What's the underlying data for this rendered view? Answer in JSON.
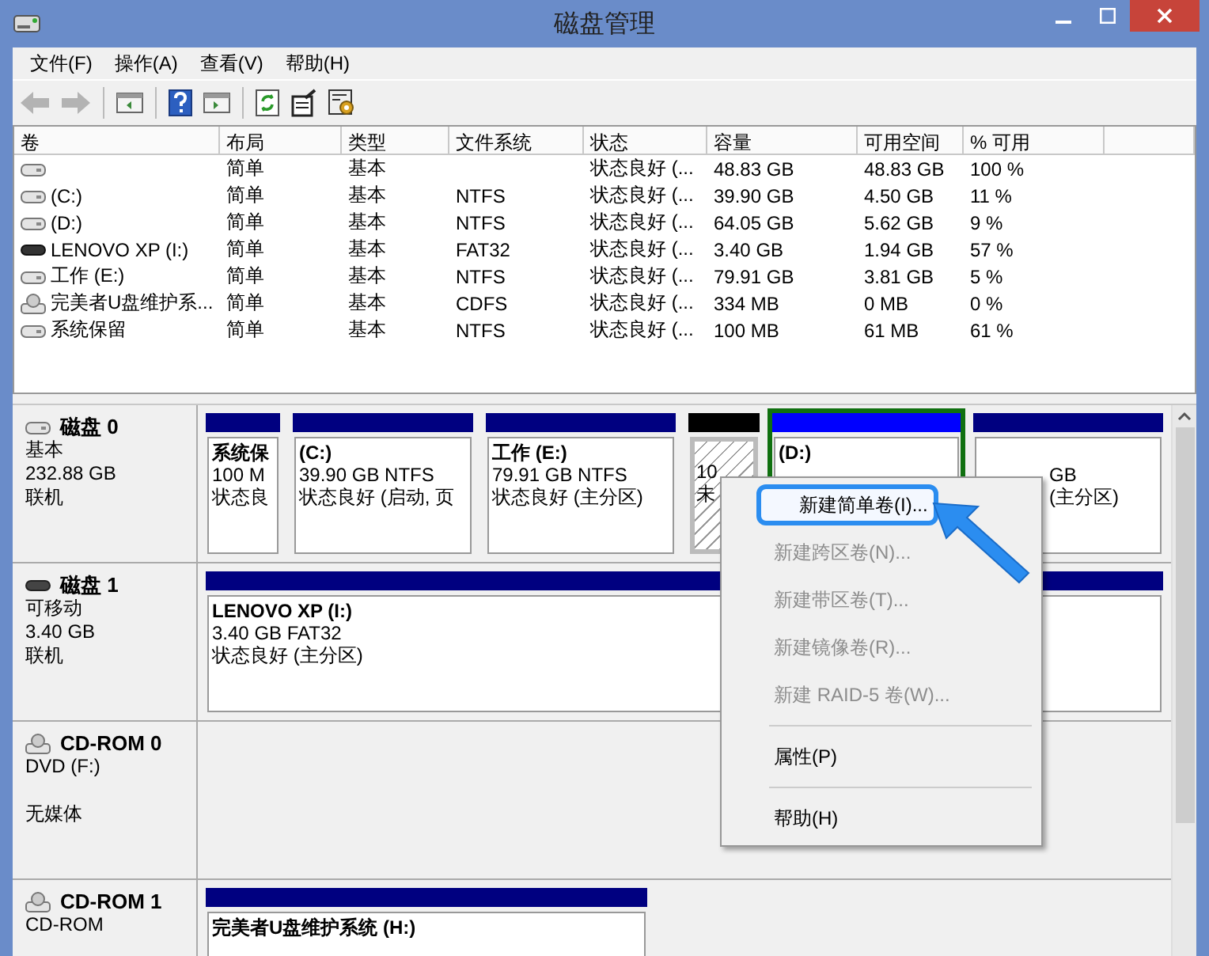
{
  "window": {
    "title": "磁盘管理"
  },
  "menu": [
    "文件(F)",
    "操作(A)",
    "查看(V)",
    "帮助(H)"
  ],
  "toolbar": [
    {
      "kind": "back",
      "disabled": true
    },
    {
      "kind": "forward",
      "disabled": true
    },
    {
      "kind": "sep"
    },
    {
      "kind": "pane"
    },
    {
      "kind": "sep"
    },
    {
      "kind": "help"
    },
    {
      "kind": "pane2"
    },
    {
      "kind": "sep"
    },
    {
      "kind": "refresh"
    },
    {
      "kind": "properties"
    },
    {
      "kind": "settings"
    }
  ],
  "table": {
    "columns": [
      "卷",
      "布局",
      "类型",
      "文件系统",
      "状态",
      "容量",
      "可用空间",
      "% 可用"
    ],
    "rows": [
      {
        "kind": "disk",
        "cells": [
          "",
          "简单",
          "基本",
          "",
          "状态良好 (...",
          "48.83 GB",
          "48.83 GB",
          "100 %"
        ]
      },
      {
        "kind": "disk",
        "cells": [
          "(C:)",
          "简单",
          "基本",
          "NTFS",
          "状态良好 (...",
          "39.90 GB",
          "4.50 GB",
          "11 %"
        ]
      },
      {
        "kind": "disk",
        "cells": [
          "(D:)",
          "简单",
          "基本",
          "NTFS",
          "状态良好 (...",
          "64.05 GB",
          "5.62 GB",
          "9 %"
        ]
      },
      {
        "kind": "usb",
        "cells": [
          "LENOVO XP (I:)",
          "简单",
          "基本",
          "FAT32",
          "状态良好 (...",
          "3.40 GB",
          "1.94 GB",
          "57 %"
        ]
      },
      {
        "kind": "disk",
        "cells": [
          "工作 (E:)",
          "简单",
          "基本",
          "NTFS",
          "状态良好 (...",
          "79.91 GB",
          "3.81 GB",
          "5 %"
        ]
      },
      {
        "kind": "cd",
        "cells": [
          "完美者U盘维护系...",
          "简单",
          "基本",
          "CDFS",
          "状态良好 (...",
          "334 MB",
          "0 MB",
          "0 %"
        ]
      },
      {
        "kind": "disk",
        "cells": [
          "系统保留",
          "简单",
          "基本",
          "NTFS",
          "状态良好 (...",
          "100 MB",
          "61 MB",
          "61 %"
        ]
      }
    ]
  },
  "disks": [
    {
      "kind": "disk",
      "name": "磁盘 0",
      "info": [
        "基本",
        "232.88 GB"
      ],
      "status": "联机",
      "partitions": [
        {
          "kind": "primary",
          "selected": false,
          "covered": false,
          "lines": [
            "系统保",
            "100 M",
            "状态良"
          ]
        },
        {
          "kind": "primary",
          "selected": false,
          "covered": false,
          "lines": [
            "(C:)",
            "39.90 GB NTFS",
            "状态良好 (启动, 页"
          ]
        },
        {
          "kind": "primary",
          "selected": false,
          "covered": false,
          "lines": [
            "工作  (E:)",
            "79.91 GB NTFS",
            "状态良好 (主分区)"
          ]
        },
        {
          "kind": "unallocated",
          "selected": false,
          "covered": false,
          "lines": [
            "10",
            "未"
          ]
        },
        {
          "kind": "logical",
          "selected": true,
          "covered": false,
          "lines": [
            "(D:)"
          ]
        },
        {
          "kind": "primary",
          "selected": false,
          "covered": true,
          "lines": [
            "GB",
            "(主分区)"
          ]
        }
      ]
    },
    {
      "kind": "usb",
      "name": "磁盘 1",
      "info": [
        "可移动",
        "3.40 GB"
      ],
      "status": "联机",
      "partitions": [
        {
          "kind": "primary",
          "selected": false,
          "covered": false,
          "lines": [
            "LENOVO XP  (I:)",
            "3.40 GB FAT32",
            "状态良好 (主分区)"
          ]
        }
      ]
    },
    {
      "kind": "cd",
      "name": "CD-ROM 0",
      "info": [
        "DVD (F:)"
      ],
      "status": "无媒体"
    },
    {
      "kind": "cd",
      "name": "CD-ROM 1",
      "info": [
        "CD-ROM"
      ],
      "partitions": [
        {
          "kind": "primary",
          "selected": false,
          "covered": false,
          "lines": [
            "完美者U盘维护系统  (H:)"
          ]
        }
      ]
    }
  ],
  "context_menu": [
    {
      "kind": "item",
      "label": "新建简单卷(I)...",
      "disabled": false,
      "highlighted": true
    },
    {
      "kind": "item",
      "label": "新建跨区卷(N)...",
      "disabled": true,
      "highlighted": false
    },
    {
      "kind": "item",
      "label": "新建带区卷(T)...",
      "disabled": true,
      "highlighted": false
    },
    {
      "kind": "item",
      "label": "新建镜像卷(R)...",
      "disabled": true,
      "highlighted": false
    },
    {
      "kind": "item",
      "label": "新建 RAID-5 卷(W)...",
      "disabled": true,
      "highlighted": false
    },
    {
      "kind": "sep"
    },
    {
      "kind": "item",
      "label": "属性(P)",
      "disabled": false,
      "highlighted": false
    },
    {
      "kind": "sep"
    },
    {
      "kind": "item",
      "label": "帮助(H)",
      "disabled": false,
      "highlighted": false
    }
  ]
}
